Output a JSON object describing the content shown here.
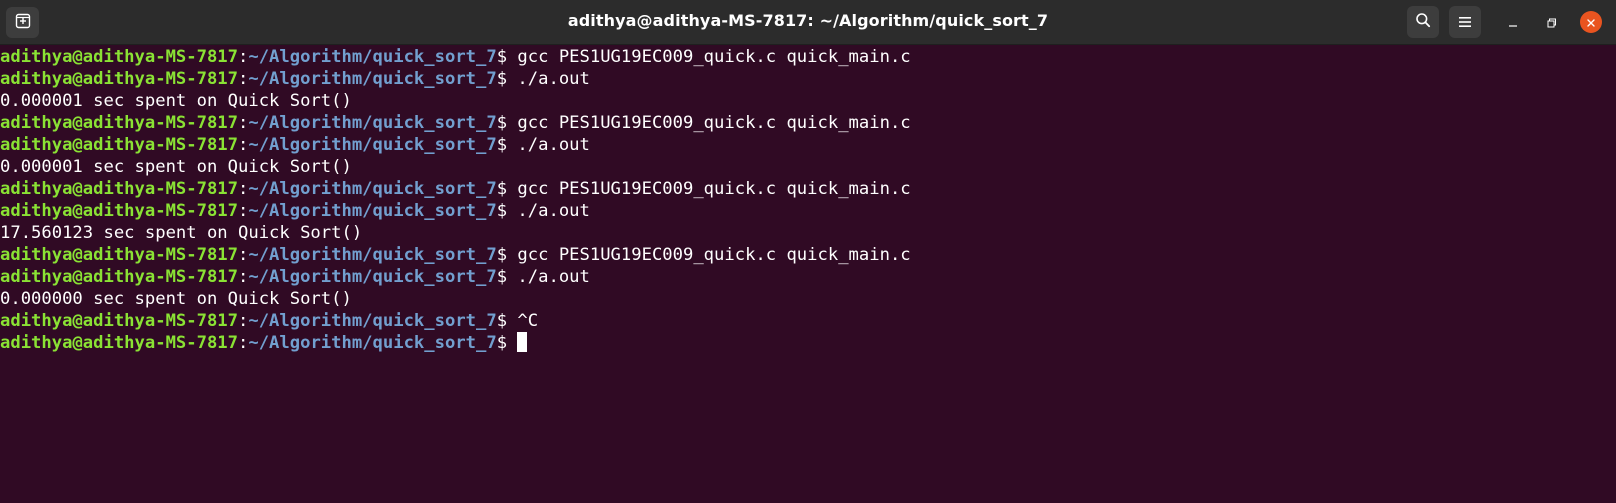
{
  "window": {
    "title": "adithya@adithya-MS-7817: ~/Algorithm/quick_sort_7"
  },
  "icons": {
    "new_tab": "new-tab-icon",
    "search": "search-icon",
    "menu": "hamburger-menu-icon",
    "minimize": "minimize-icon",
    "maximize": "maximize-icon",
    "close": "close-icon"
  },
  "colors": {
    "background": "#300a24",
    "titlebar": "#2c2c2c",
    "prompt_user": "#8ae234",
    "prompt_path": "#729fcf",
    "close_button": "#e95420"
  },
  "prompt": {
    "user_host": "adithya@adithya-MS-7817",
    "separator": ":",
    "path": "~/Algorithm/quick_sort_7",
    "symbol": "$ "
  },
  "terminal": {
    "lines": [
      {
        "type": "prompt",
        "command": "gcc PES1UG19EC009_quick.c quick_main.c"
      },
      {
        "type": "prompt",
        "command": "./a.out"
      },
      {
        "type": "output",
        "text": "0.000001 sec spent on Quick Sort()"
      },
      {
        "type": "prompt",
        "command": "gcc PES1UG19EC009_quick.c quick_main.c"
      },
      {
        "type": "prompt",
        "command": "./a.out"
      },
      {
        "type": "output",
        "text": "0.000001 sec spent on Quick Sort()"
      },
      {
        "type": "prompt",
        "command": "gcc PES1UG19EC009_quick.c quick_main.c"
      },
      {
        "type": "prompt",
        "command": "./a.out"
      },
      {
        "type": "output",
        "text": "17.560123 sec spent on Quick Sort()"
      },
      {
        "type": "prompt",
        "command": "gcc PES1UG19EC009_quick.c quick_main.c"
      },
      {
        "type": "prompt",
        "command": "./a.out"
      },
      {
        "type": "output",
        "text": "0.000000 sec spent on Quick Sort()"
      },
      {
        "type": "prompt",
        "command": "^C"
      },
      {
        "type": "prompt",
        "command": "",
        "cursor": true
      }
    ]
  }
}
